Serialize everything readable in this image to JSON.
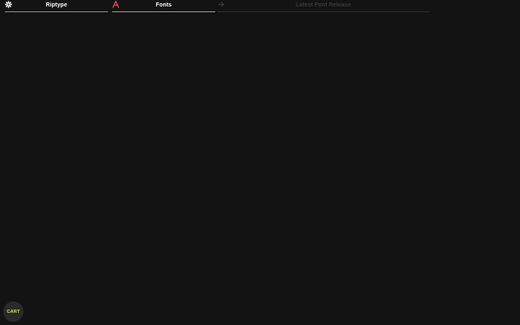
{
  "nav": {
    "tabs": [
      {
        "label": "Riptype",
        "icon": "gear-icon"
      },
      {
        "label": "Fonts",
        "icon": "letter-a-icon"
      },
      {
        "label": "Latest Font Release",
        "icon": "arrow-right-icon"
      }
    ]
  },
  "cart": {
    "label": "CART"
  },
  "colors": {
    "background": "#131313",
    "fonts_icon": "#e0474a",
    "cart_text": "#d8e64a"
  }
}
